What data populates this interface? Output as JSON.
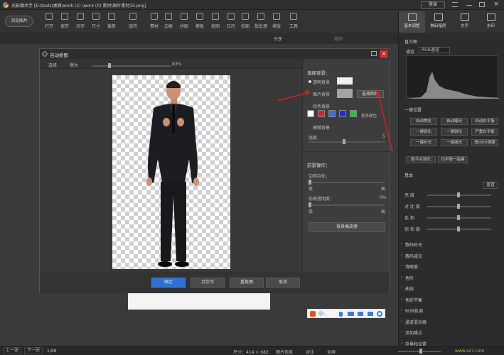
{
  "app": {
    "title": "光影魔术手 [E:\\tools\\桌面\\work (2) \\work (0) 素材\\图片素材15.png]",
    "browse_btn": "浏览图片",
    "login": "登录"
  },
  "toolbar": [
    "打开",
    "保存",
    "另存",
    "尺寸",
    "裁剪",
    "旋转",
    "素材",
    "边框",
    "拼图",
    "模板",
    "抠图",
    "日历",
    "拍图",
    "批处理",
    "排版",
    "工具"
  ],
  "subbar": {
    "share": "分享",
    "undo": "撤销"
  },
  "right_tabs": [
    "基本调整",
    "数码暗房",
    "文字",
    "水印"
  ],
  "histogram": {
    "label": "直方图",
    "channel_label": "通道",
    "channel": "RGB通道"
  },
  "one_click": {
    "title": "一键设置",
    "buttons": [
      "自动美化",
      "自动曝光",
      "自动白平衡",
      "一键锐化",
      "一键锐化",
      "严重白平衡",
      "一键补光",
      "一键减光",
      "造ODD弹爆"
    ],
    "extra": [
      "数字点测光",
      "白平衡一指键"
    ]
  },
  "basic": {
    "title": "基本",
    "reset": "重置",
    "rows": [
      "亮 度",
      "对 比 度",
      "色 相",
      "饱 和 度"
    ]
  },
  "sections": [
    "数码补光",
    "数码减光",
    "清晰度",
    "色阶",
    "曲线",
    "色彩平衡",
    "RGB色调",
    "通道混合器",
    "添加噪点",
    "存量和设置"
  ],
  "dialog": {
    "title": "自动抠图",
    "tool1": "选择",
    "tool2": "擦大",
    "zoom": "83%",
    "bg_title": "选择背景：",
    "bg_transparent": "透明背景",
    "bg_image": "图片背景",
    "choose_image": "选择图片",
    "color_bg": "纯色背景",
    "more_colors": "更多颜色",
    "blur_bg": "模糊背景",
    "strength": "强度",
    "strength_val": "5",
    "fg_title": "前景操作：",
    "edge_feather": "边缘羽化：",
    "low": "低",
    "high": "高",
    "fg_opacity": "前景透明度：",
    "opacity_val": "0%",
    "bg_edit": "背景橡皮擦",
    "confirm": "确定",
    "save_as": "另存为",
    "redo": "重抠图",
    "cancel": "取消"
  },
  "swatches": [
    "#ffffff",
    "#e02020",
    "#3a6fd8",
    "#1a2fd8",
    "#22c23a"
  ],
  "status": {
    "prev": "上一张",
    "next": "下一张",
    "file_num": "1/88",
    "size": "尺寸：414 × 682",
    "info": "图片信息",
    "compare": "对比",
    "fullscreen": "全屏"
  },
  "watermark": "www.xz7.com"
}
